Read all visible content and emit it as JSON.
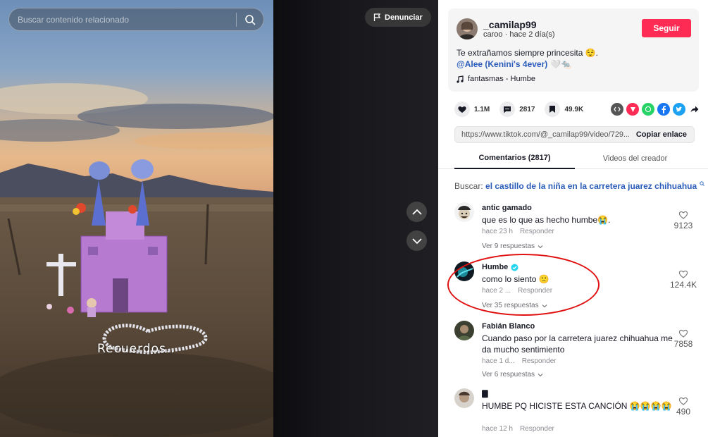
{
  "search": {
    "placeholder": "Buscar contenido relacionado"
  },
  "video": {
    "report_label": "Denunciar",
    "overlay_text": "Recuerdos.."
  },
  "author": {
    "username": "_camilap99",
    "nickname": "caroo",
    "time": "hace 2 día(s)",
    "follow_label": "Seguir"
  },
  "caption": {
    "text": "Te extrañamos siempre princesita 😌.",
    "mention": "@Alee (Kenini's 4ever)",
    "mention_suffix": "🤍🐀",
    "music": "fantasmas - Humbe"
  },
  "stats": {
    "likes": "1.1M",
    "comments": "2817",
    "saves": "49.9K"
  },
  "share_icons": [
    "embed-icon",
    "tiktok-friends-icon",
    "whatsapp-icon",
    "facebook-icon",
    "twitter-icon",
    "share-arrow-icon"
  ],
  "link": {
    "url": "https://www.tiktok.com/@_camilap99/video/729...",
    "copy_label": "Copiar enlace"
  },
  "tabs": [
    {
      "label": "Comentarios (2817)",
      "active": true
    },
    {
      "label": "Videos del creador",
      "active": false
    }
  ],
  "search_suggestion": {
    "label": "Buscar:",
    "term": "el castillo de la niña en la carretera juarez chihuahua"
  },
  "comments": [
    {
      "user": "antic gamado",
      "text": "que es lo que as hecho humbe😭.",
      "time": "hace 23 h",
      "reply_label": "Responder",
      "replies": "Ver 9 respuestas",
      "likes": "9123"
    },
    {
      "user": "Humbe",
      "verified": true,
      "text": "como lo siento 🙁",
      "time": "hace 2 ...",
      "reply_label": "Responder",
      "replies": "Ver 35 respuestas",
      "likes": "124.4K"
    },
    {
      "user": "Fabián Blanco",
      "text": "Cuando paso por la carretera juarez chihuahua me da mucho sentimiento",
      "time": "hace 1 d...",
      "reply_label": "Responder",
      "replies": "Ver 6 respuestas",
      "likes": "7858"
    },
    {
      "user": "🀫",
      "text": "HUMBE PQ HICISTE ESTA CANCIÓN 😭😭😭😭",
      "time": "hace 12 h",
      "reply_label": "Responder",
      "likes": "490"
    }
  ],
  "colors": {
    "follow_red": "#fe2c55",
    "link_blue": "#2b5db9",
    "annotation_red": "#e01010"
  }
}
